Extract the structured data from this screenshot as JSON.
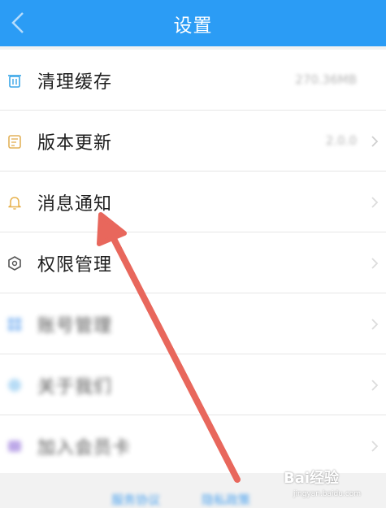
{
  "header": {
    "title": "设置",
    "background": "#2b9cf5",
    "back_icon": "chevron-left-icon"
  },
  "settings": {
    "items": [
      {
        "label": "清理缓存",
        "value": "270.36MB",
        "icon": "trash-icon",
        "icon_color": "#3aa6e8",
        "blurred": false
      },
      {
        "label": "版本更新",
        "value": "2.0.0",
        "icon": "calendar-icon",
        "icon_color": "#e3b25a",
        "blurred": false
      },
      {
        "label": "消息通知",
        "value": "",
        "icon": "bell-icon",
        "icon_color": "#e7b04a",
        "blurred": false
      },
      {
        "label": "权限管理",
        "value": "",
        "icon": "hexagon-icon",
        "icon_color": "#555555",
        "blurred": false
      },
      {
        "label": "账号管理",
        "value": "",
        "icon": "grid-icon",
        "icon_color": "#6aa8ef",
        "blurred": true
      },
      {
        "label": "关于我们",
        "value": "",
        "icon": "info-icon",
        "icon_color": "#9fd0f2",
        "blurred": true
      },
      {
        "label": "加入会员卡",
        "value": "",
        "icon": "card-icon",
        "icon_color": "#a78be0",
        "blurred": true
      }
    ]
  },
  "bottom": {
    "left_link": "服务协议",
    "right_link": "隐私政策"
  },
  "watermark": {
    "text": "Bai经验",
    "url": "jingyan.baidu.com"
  },
  "annotation": {
    "arrow_color": "#e8675c"
  }
}
